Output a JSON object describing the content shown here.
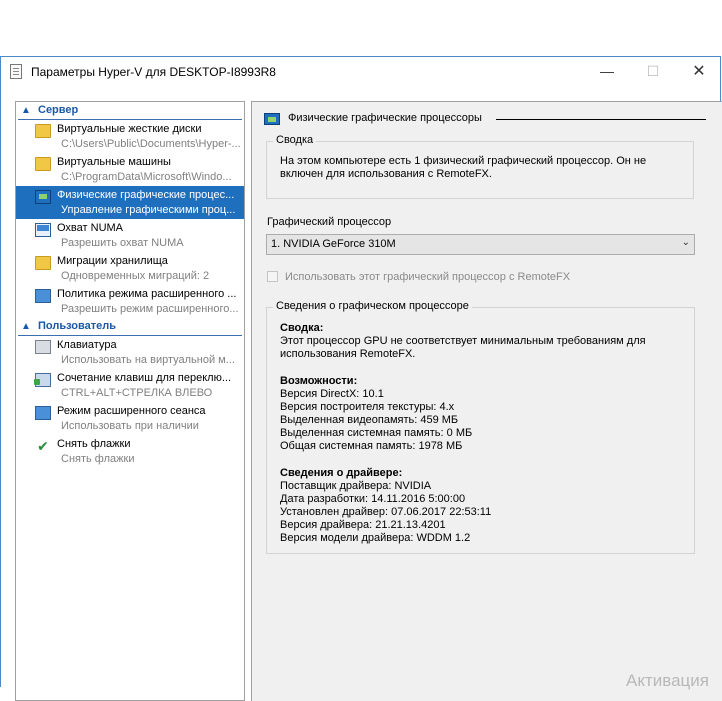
{
  "window": {
    "title": "Параметры Hyper-V для DESKTOP-I8993R8",
    "min_glyph": "—",
    "max_glyph": "☐",
    "close_glyph": "✕"
  },
  "sidebar": {
    "server_header": "Сервер",
    "user_header": "Пользователь",
    "server_items": [
      {
        "title": "Виртуальные жесткие диски",
        "sub": "C:\\Users\\Public\\Documents\\Hyper-...",
        "icon": "hard-disk-folder-icon"
      },
      {
        "title": "Виртуальные машины",
        "sub": "C:\\ProgramData\\Microsoft\\Windo...",
        "icon": "vm-folder-icon"
      },
      {
        "title": "Физические графические процес...",
        "sub": "Управление графическими проц...",
        "icon": "gpu-icon"
      },
      {
        "title": "Охват NUMA",
        "sub": "Разрешить охват NUMA",
        "icon": "numa-icon"
      },
      {
        "title": "Миграции хранилища",
        "sub": "Одновременных миграций: 2",
        "icon": "storage-migration-icon"
      },
      {
        "title": "Политика режима расширенного ...",
        "sub": "Разрешить режим расширенного...",
        "icon": "enhanced-session-policy-icon"
      }
    ],
    "user_items": [
      {
        "title": "Клавиатура",
        "sub": "Использовать на виртуальной м...",
        "icon": "keyboard-icon"
      },
      {
        "title": "Сочетание клавиш для переклю...",
        "sub": "CTRL+ALT+СТРЕЛКА ВЛЕВО",
        "icon": "key-combination-icon"
      },
      {
        "title": "Режим расширенного сеанса",
        "sub": "Использовать при наличии",
        "icon": "enhanced-session-icon"
      },
      {
        "title": "Снять флажки",
        "sub": "Снять флажки",
        "icon": "reset-checkboxes-icon"
      }
    ]
  },
  "main": {
    "header": "Физические графические процессоры",
    "summary_title": "Сводка",
    "summary_text": "На этом компьютере есть 1 физический графический процессор. Он не включен для использования с RemoteFX.",
    "gpu_label": "Графический процессор",
    "gpu_selected": "1. NVIDIA GeForce 310M",
    "use_remotefx_label": "Использовать этот графический процессор с RemoteFX",
    "details_title": "Сведения о графическом процессоре",
    "details": {
      "summary_heading": "Сводка:",
      "summary_text": "Этот процессор GPU не соответствует минимальным требованиям для использования RemoteFX.",
      "capabilities_heading": "Возможности:",
      "capabilities": [
        "Версия DirectX: 10.1",
        "Версия построителя текстуры: 4.x",
        "Выделенная видеопамять: 459 МБ",
        "Выделенная системная память: 0 МБ",
        "Общая системная память: 1978 МБ"
      ],
      "driver_heading": "Сведения о драйвере:",
      "driver": [
        "Поставщик драйвера: NVIDIA",
        "Дата разработки: 14.11.2016 5:00:00",
        "Установлен драйвер: 07.06.2017 22:53:11",
        "Версия драйвера: 21.21.13.4201",
        "Версия модели драйвера: WDDM 1.2"
      ]
    }
  },
  "watermark": "Активация"
}
